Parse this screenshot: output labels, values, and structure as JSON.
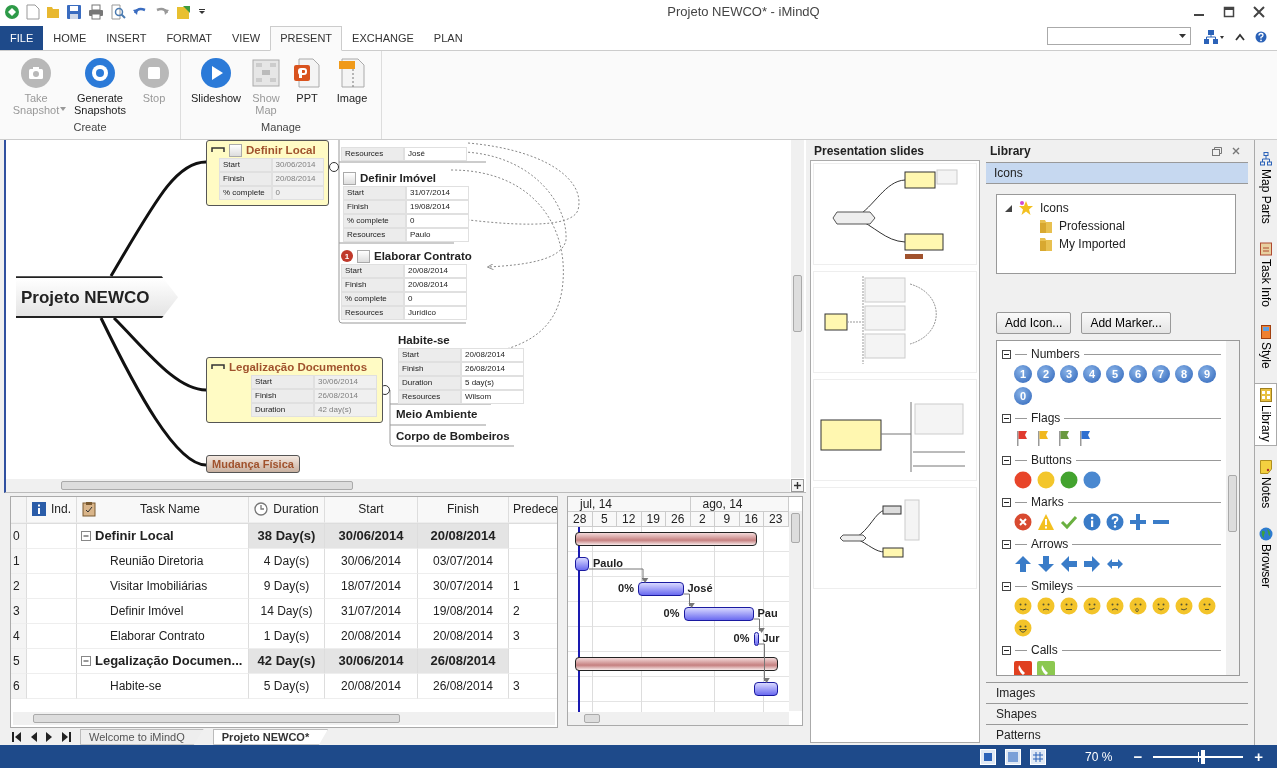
{
  "window": {
    "title": "Projeto NEWCO* - iMindQ"
  },
  "ribbon_tabs": [
    {
      "label": "FILE",
      "kind": "file",
      "selected": false
    },
    {
      "label": "HOME",
      "kind": "tab",
      "selected": false
    },
    {
      "label": "INSERT",
      "kind": "tab",
      "selected": false
    },
    {
      "label": "FORMAT",
      "kind": "tab",
      "selected": false
    },
    {
      "label": "VIEW",
      "kind": "tab",
      "selected": false
    },
    {
      "label": "PRESENT",
      "kind": "tab",
      "selected": true
    },
    {
      "label": "EXCHANGE",
      "kind": "tab",
      "selected": false
    },
    {
      "label": "PLAN",
      "kind": "tab",
      "selected": false
    }
  ],
  "ribbon_groups": [
    {
      "label": "Create",
      "buttons": [
        {
          "label": "Take Snapshot",
          "kind": "camera",
          "disabled": true,
          "dropdown": true
        },
        {
          "label": "Generate Snapshots",
          "kind": "target",
          "disabled": false
        },
        {
          "label": "Stop",
          "kind": "stop",
          "disabled": true
        }
      ]
    },
    {
      "label": "Manage",
      "buttons": [
        {
          "label": "Slideshow",
          "kind": "play",
          "disabled": false
        },
        {
          "label": "Show Map",
          "kind": "map",
          "disabled": true
        },
        {
          "label": "PPT",
          "kind": "ppt",
          "disabled": false
        },
        {
          "label": "Image",
          "kind": "image",
          "disabled": false
        }
      ]
    }
  ],
  "mind_map": {
    "nodes": [
      {
        "kind": "root",
        "title": "Projeto NEWCO"
      },
      {
        "kind": "summary",
        "title": "Definir Local",
        "checked": false,
        "fields": [
          {
            "label": "Start",
            "value": "30/06/2014"
          },
          {
            "label": "Finish",
            "value": "20/08/2014"
          },
          {
            "label": "% complete",
            "value": "0"
          }
        ]
      },
      {
        "kind": "fields",
        "fields": [
          {
            "label": "Resources",
            "value": "José"
          }
        ]
      },
      {
        "kind": "task",
        "title": "Definir Imóvel",
        "checked": false,
        "fields": [
          {
            "label": "Start",
            "value": "31/07/2014"
          },
          {
            "label": "Finish",
            "value": "19/08/2014"
          },
          {
            "label": "% complete",
            "value": "0"
          },
          {
            "label": "Resources",
            "value": "Paulo"
          }
        ]
      },
      {
        "kind": "task",
        "title": "Elaborar Contrato",
        "priority": "1",
        "checked": false,
        "fields": [
          {
            "label": "Start",
            "value": "20/08/2014"
          },
          {
            "label": "Finish",
            "value": "20/08/2014"
          },
          {
            "label": "% complete",
            "value": "0"
          },
          {
            "label": "Resources",
            "value": "Jurídico"
          }
        ]
      },
      {
        "kind": "summary",
        "title": "Legalização Documentos",
        "fields": [
          {
            "label": "Start",
            "value": "30/06/2014"
          },
          {
            "label": "Finish",
            "value": "26/08/2014"
          },
          {
            "label": "Duration",
            "value": "42 day(s)"
          }
        ]
      },
      {
        "kind": "task",
        "title": "Habite-se",
        "fields": [
          {
            "label": "Start",
            "value": "20/08/2014"
          },
          {
            "label": "Finish",
            "value": "26/08/2014"
          },
          {
            "label": "Duration",
            "value": "5 day(s)"
          },
          {
            "label": "Resources",
            "value": "Wilsom"
          }
        ]
      },
      {
        "kind": "topic",
        "title": "Meio Ambiente"
      },
      {
        "kind": "topic",
        "title": "Corpo de Bombeiros"
      },
      {
        "kind": "button",
        "title": "Mudança Física"
      }
    ]
  },
  "task_table": {
    "columns": [
      {
        "kind": "number"
      },
      {
        "kind": "indicator",
        "label": "Ind."
      },
      {
        "kind": "name",
        "label": "Task Name"
      },
      {
        "kind": "duration",
        "label": "Duration"
      },
      {
        "kind": "start",
        "label": "Start"
      },
      {
        "kind": "finish",
        "label": "Finish"
      },
      {
        "kind": "predecessors",
        "label": "Predece"
      }
    ],
    "rows": [
      {
        "id": "0",
        "kind": "summary",
        "expanded": true,
        "name": "Definir Local",
        "duration": "38 Day(s)",
        "start": "30/06/2014",
        "finish": "20/08/2014"
      },
      {
        "id": "1",
        "kind": "task",
        "name": "Reunião Diretoria",
        "duration": "4 Day(s)",
        "start": "30/06/2014",
        "finish": "03/07/2014"
      },
      {
        "id": "2",
        "kind": "task",
        "name": "Visitar Imobiliárias",
        "duration": "9 Day(s)",
        "start": "18/07/2014",
        "finish": "30/07/2014",
        "predecessors": "1"
      },
      {
        "id": "3",
        "kind": "task",
        "name": "Definir Imóvel",
        "duration": "14 Day(s)",
        "start": "31/07/2014",
        "finish": "19/08/2014",
        "predecessors": "2"
      },
      {
        "id": "4",
        "kind": "task",
        "name": "Elaborar Contrato",
        "duration": "1 Day(s)",
        "start": "20/08/2014",
        "finish": "20/08/2014",
        "predecessors": "3"
      },
      {
        "id": "5",
        "kind": "summary",
        "expanded": true,
        "name": "Legalização Documen...",
        "duration": "42 Day(s)",
        "start": "30/06/2014",
        "finish": "26/08/2014"
      },
      {
        "id": "6",
        "kind": "task",
        "name": "Habite-se",
        "duration": "5 Day(s)",
        "start": "20/08/2014",
        "finish": "26/08/2014",
        "predecessors": "3"
      }
    ]
  },
  "gantt": {
    "months": [
      "jul, 14",
      "ago, 14"
    ],
    "weeks": [
      "28",
      "5",
      "12",
      "19",
      "26",
      "2",
      "9",
      "16",
      "23"
    ],
    "bars": [
      {
        "kind": "summary"
      },
      {
        "kind": "task",
        "resource": "Paulo"
      },
      {
        "kind": "task",
        "progress": "0%",
        "resource": "José"
      },
      {
        "kind": "task",
        "progress": "0%",
        "resource": "Pau"
      },
      {
        "kind": "task",
        "progress": "0%",
        "resource": "Jur"
      },
      {
        "kind": "summary"
      },
      {
        "kind": "task"
      }
    ]
  },
  "sheet_tabs": [
    {
      "label": "Welcome to iMindQ",
      "selected": false
    },
    {
      "label": "Projeto NEWCO*",
      "selected": true
    }
  ],
  "presentation": {
    "title": "Presentation slides",
    "slides": [
      {
        "kind": "map"
      },
      {
        "kind": "tasks"
      },
      {
        "kind": "branch"
      },
      {
        "kind": "map-small"
      }
    ]
  },
  "library": {
    "title": "Library",
    "section": "Icons",
    "tree": {
      "label": "Icons",
      "expanded": true,
      "children": [
        {
          "label": "Professional"
        },
        {
          "label": "My Imported"
        }
      ]
    },
    "buttons": [
      "Add Icon...",
      "Add Marker..."
    ],
    "groups": [
      {
        "label": "Numbers",
        "expanded": true,
        "icons": [
          {
            "kind": "number",
            "text": "1"
          },
          {
            "kind": "number",
            "text": "2"
          },
          {
            "kind": "number",
            "text": "3"
          },
          {
            "kind": "number",
            "text": "4"
          },
          {
            "kind": "number",
            "text": "5"
          },
          {
            "kind": "number",
            "text": "6"
          },
          {
            "kind": "number",
            "text": "7"
          },
          {
            "kind": "number",
            "text": "8"
          },
          {
            "kind": "number",
            "text": "9"
          },
          {
            "kind": "number",
            "text": "0"
          }
        ]
      },
      {
        "label": "Flags",
        "expanded": true,
        "icons": [
          {
            "kind": "flag",
            "color": "#e03a2f"
          },
          {
            "kind": "flag",
            "color": "#f0b820"
          },
          {
            "kind": "flag",
            "color": "#6a9a40"
          },
          {
            "kind": "flag",
            "color": "#2f6fd0"
          }
        ]
      },
      {
        "label": "Buttons",
        "expanded": true,
        "icons": [
          {
            "kind": "ball",
            "color": "#e8452a"
          },
          {
            "kind": "ball",
            "color": "#f3c62b"
          },
          {
            "kind": "ball",
            "color": "#43a32f"
          },
          {
            "kind": "ball",
            "color": "#4a88d0"
          }
        ]
      },
      {
        "label": "Marks",
        "expanded": true,
        "icons": [
          {
            "kind": "cross"
          },
          {
            "kind": "warning"
          },
          {
            "kind": "check"
          },
          {
            "kind": "info"
          },
          {
            "kind": "question"
          },
          {
            "kind": "plus"
          },
          {
            "kind": "minus"
          }
        ]
      },
      {
        "label": "Arrows",
        "expanded": true,
        "icons": [
          {
            "kind": "arrow-up"
          },
          {
            "kind": "arrow-down"
          },
          {
            "kind": "arrow-left"
          },
          {
            "kind": "arrow-right"
          },
          {
            "kind": "arrow-both"
          }
        ]
      },
      {
        "label": "Smileys",
        "expanded": true,
        "icons": [
          {
            "kind": "smiley"
          },
          {
            "kind": "smiley"
          },
          {
            "kind": "smiley"
          },
          {
            "kind": "smiley"
          },
          {
            "kind": "smiley"
          },
          {
            "kind": "smiley"
          },
          {
            "kind": "smiley"
          },
          {
            "kind": "smiley"
          },
          {
            "kind": "smiley"
          },
          {
            "kind": "smiley"
          }
        ]
      },
      {
        "label": "Calls",
        "expanded": true,
        "icons": [
          {
            "kind": "call",
            "color": "#e04020"
          },
          {
            "kind": "call",
            "color": "#8cc850"
          }
        ]
      }
    ],
    "sections": [
      "Images",
      "Shapes",
      "Patterns"
    ]
  },
  "side_tabs": [
    {
      "label": "Map Parts",
      "selected": false
    },
    {
      "label": "Task Info",
      "selected": false
    },
    {
      "label": "Style",
      "selected": false
    },
    {
      "label": "Library",
      "selected": true
    },
    {
      "label": "Notes",
      "selected": false
    },
    {
      "label": "Browser",
      "selected": false
    }
  ],
  "status_bar": {
    "zoom": "70 %",
    "zoom_out": "−",
    "zoom_in": "+",
    "zoom_slider": {
      "level": 0.55
    }
  }
}
